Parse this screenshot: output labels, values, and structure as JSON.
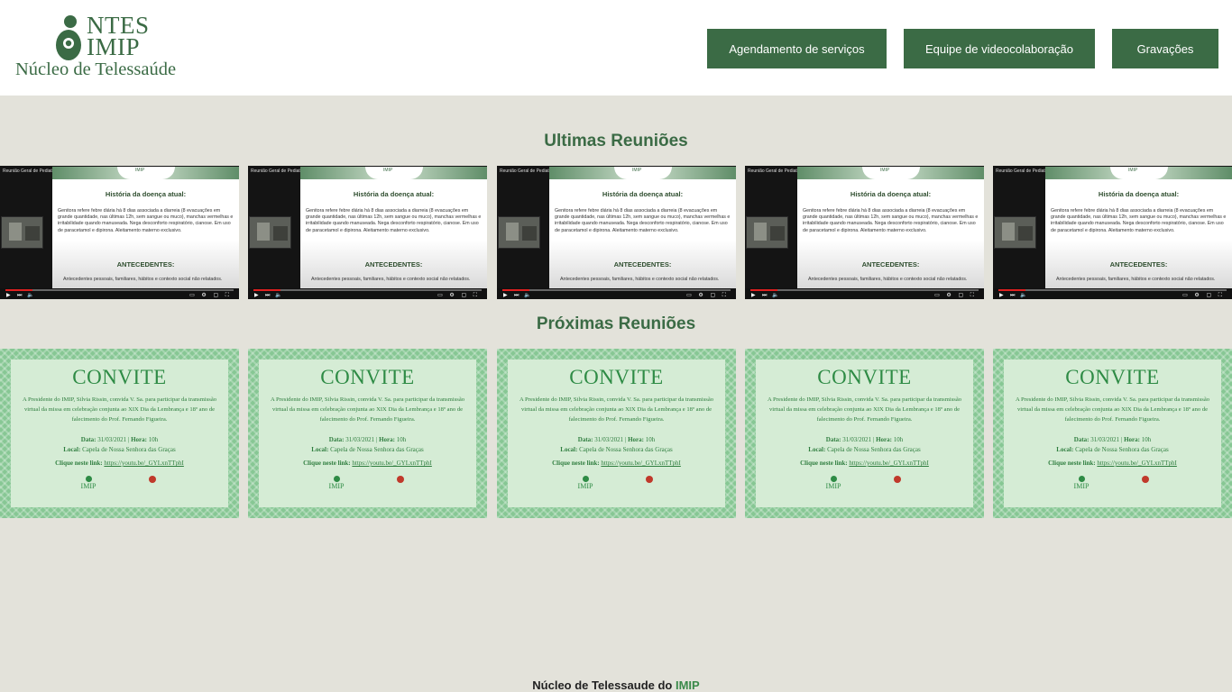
{
  "logo": {
    "line1": "NTES",
    "line2": "IMIP",
    "subtitle": "Núcleo de Telessaúde"
  },
  "nav": [
    {
      "label": "Agendamento de serviços"
    },
    {
      "label": "Equipe de videocolaboração"
    },
    {
      "label": "Gravações"
    }
  ],
  "sections": {
    "recent_title": "Ultimas Reuniões",
    "upcoming_title": "Próximas Reuniões"
  },
  "video": {
    "title": "Reunião Geral de Pediatria",
    "brand": "IMIP",
    "heading": "História da doença atual:",
    "body": "Genitora refere febre diária há 8 dias associada a diarreia (8 evacuações em grande quantidade, nas últimas 12h, sem sangue ou muco), manchas vermelhas e irritabilidade quando manuseada. Nega desconforto respiratório, cianose. Em uso de paracetamol e dipirona. Aleitamento materno exclusivo.",
    "heading2": "ANTECEDENTES:",
    "body2": "Antecedentes pessoais, familiares, hábitos e contexto social não relatados.",
    "progress": 0.12
  },
  "invite": {
    "title": "CONVITE",
    "text": "A Presidente do IMIP, Silvia Rissin, convida V. Sa. para participar da transmissão virtual da missa em celebração conjunta ao XIX Dia da Lembrança e 18º ano de falecimento do Prof. Fernando Figueira.",
    "date_label": "Data:",
    "date_value": "31/03/2021",
    "hour_label": "Hora:",
    "hour_value": "10h",
    "local_label": "Local:",
    "local_value": "Capela de Nossa Senhora das Graças",
    "link_label": "Clique neste link:",
    "link_value": "https://youtu.be/_GYLxnTTphI",
    "logo_name": "IMIP"
  },
  "footer": {
    "text": "Núcleo de Telessaude do ",
    "accent": "IMIP"
  },
  "colors": {
    "brand_green": "#3b6b45",
    "page_bg": "#e3e2da",
    "invite_green": "#87c794"
  }
}
